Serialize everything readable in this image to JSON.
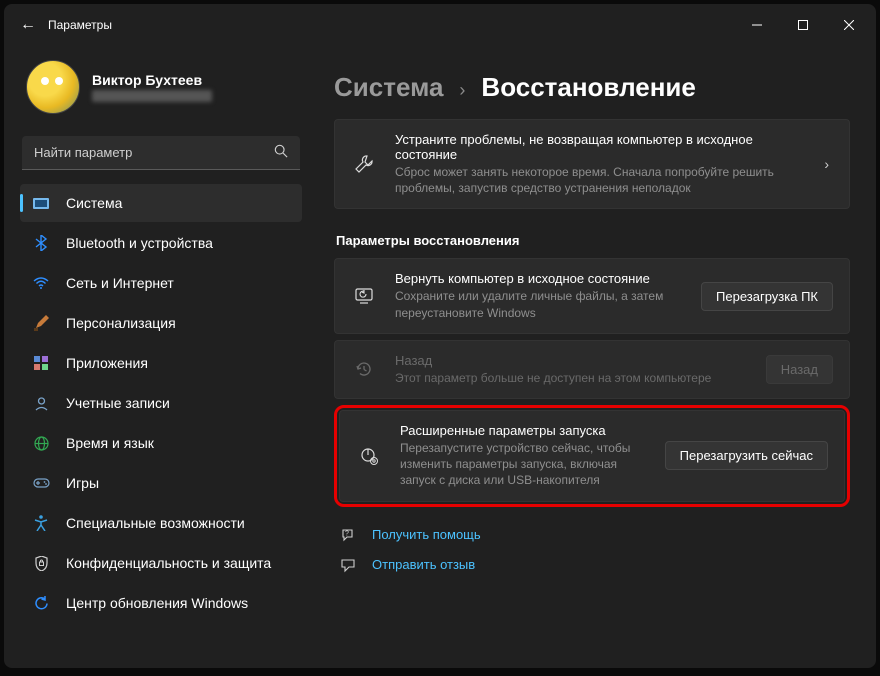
{
  "titlebar": {
    "back_glyph": "←",
    "title": "Параметры"
  },
  "profile": {
    "name": "Виктор Бухтеев"
  },
  "search": {
    "placeholder": "Найти параметр"
  },
  "nav": {
    "items": [
      {
        "label": "Система"
      },
      {
        "label": "Bluetooth и устройства"
      },
      {
        "label": "Сеть и Интернет"
      },
      {
        "label": "Персонализация"
      },
      {
        "label": "Приложения"
      },
      {
        "label": "Учетные записи"
      },
      {
        "label": "Время и язык"
      },
      {
        "label": "Игры"
      },
      {
        "label": "Специальные возможности"
      },
      {
        "label": "Конфиденциальность и защита"
      },
      {
        "label": "Центр обновления Windows"
      }
    ]
  },
  "breadcrumb": {
    "parent": "Система",
    "current": "Восстановление"
  },
  "troubleshoot": {
    "title": "Устраните проблемы, не возвращая компьютер в исходное состояние",
    "desc": "Сброс может занять некоторое время. Сначала попробуйте решить проблемы, запустив средство устранения неполадок"
  },
  "recovery_section_title": "Параметры восстановления",
  "reset": {
    "title": "Вернуть компьютер в исходное состояние",
    "desc": "Сохраните или удалите личные файлы, а затем переустановите Windows",
    "button": "Перезагрузка ПК"
  },
  "goback": {
    "title": "Назад",
    "desc": "Этот параметр больше не доступен на этом компьютере",
    "button": "Назад"
  },
  "advanced": {
    "title": "Расширенные параметры запуска",
    "desc": "Перезапустите устройство сейчас, чтобы изменить параметры запуска, включая запуск с диска или USB-накопителя",
    "button": "Перезагрузить сейчас"
  },
  "footer": {
    "help": "Получить помощь",
    "feedback": "Отправить отзыв"
  }
}
